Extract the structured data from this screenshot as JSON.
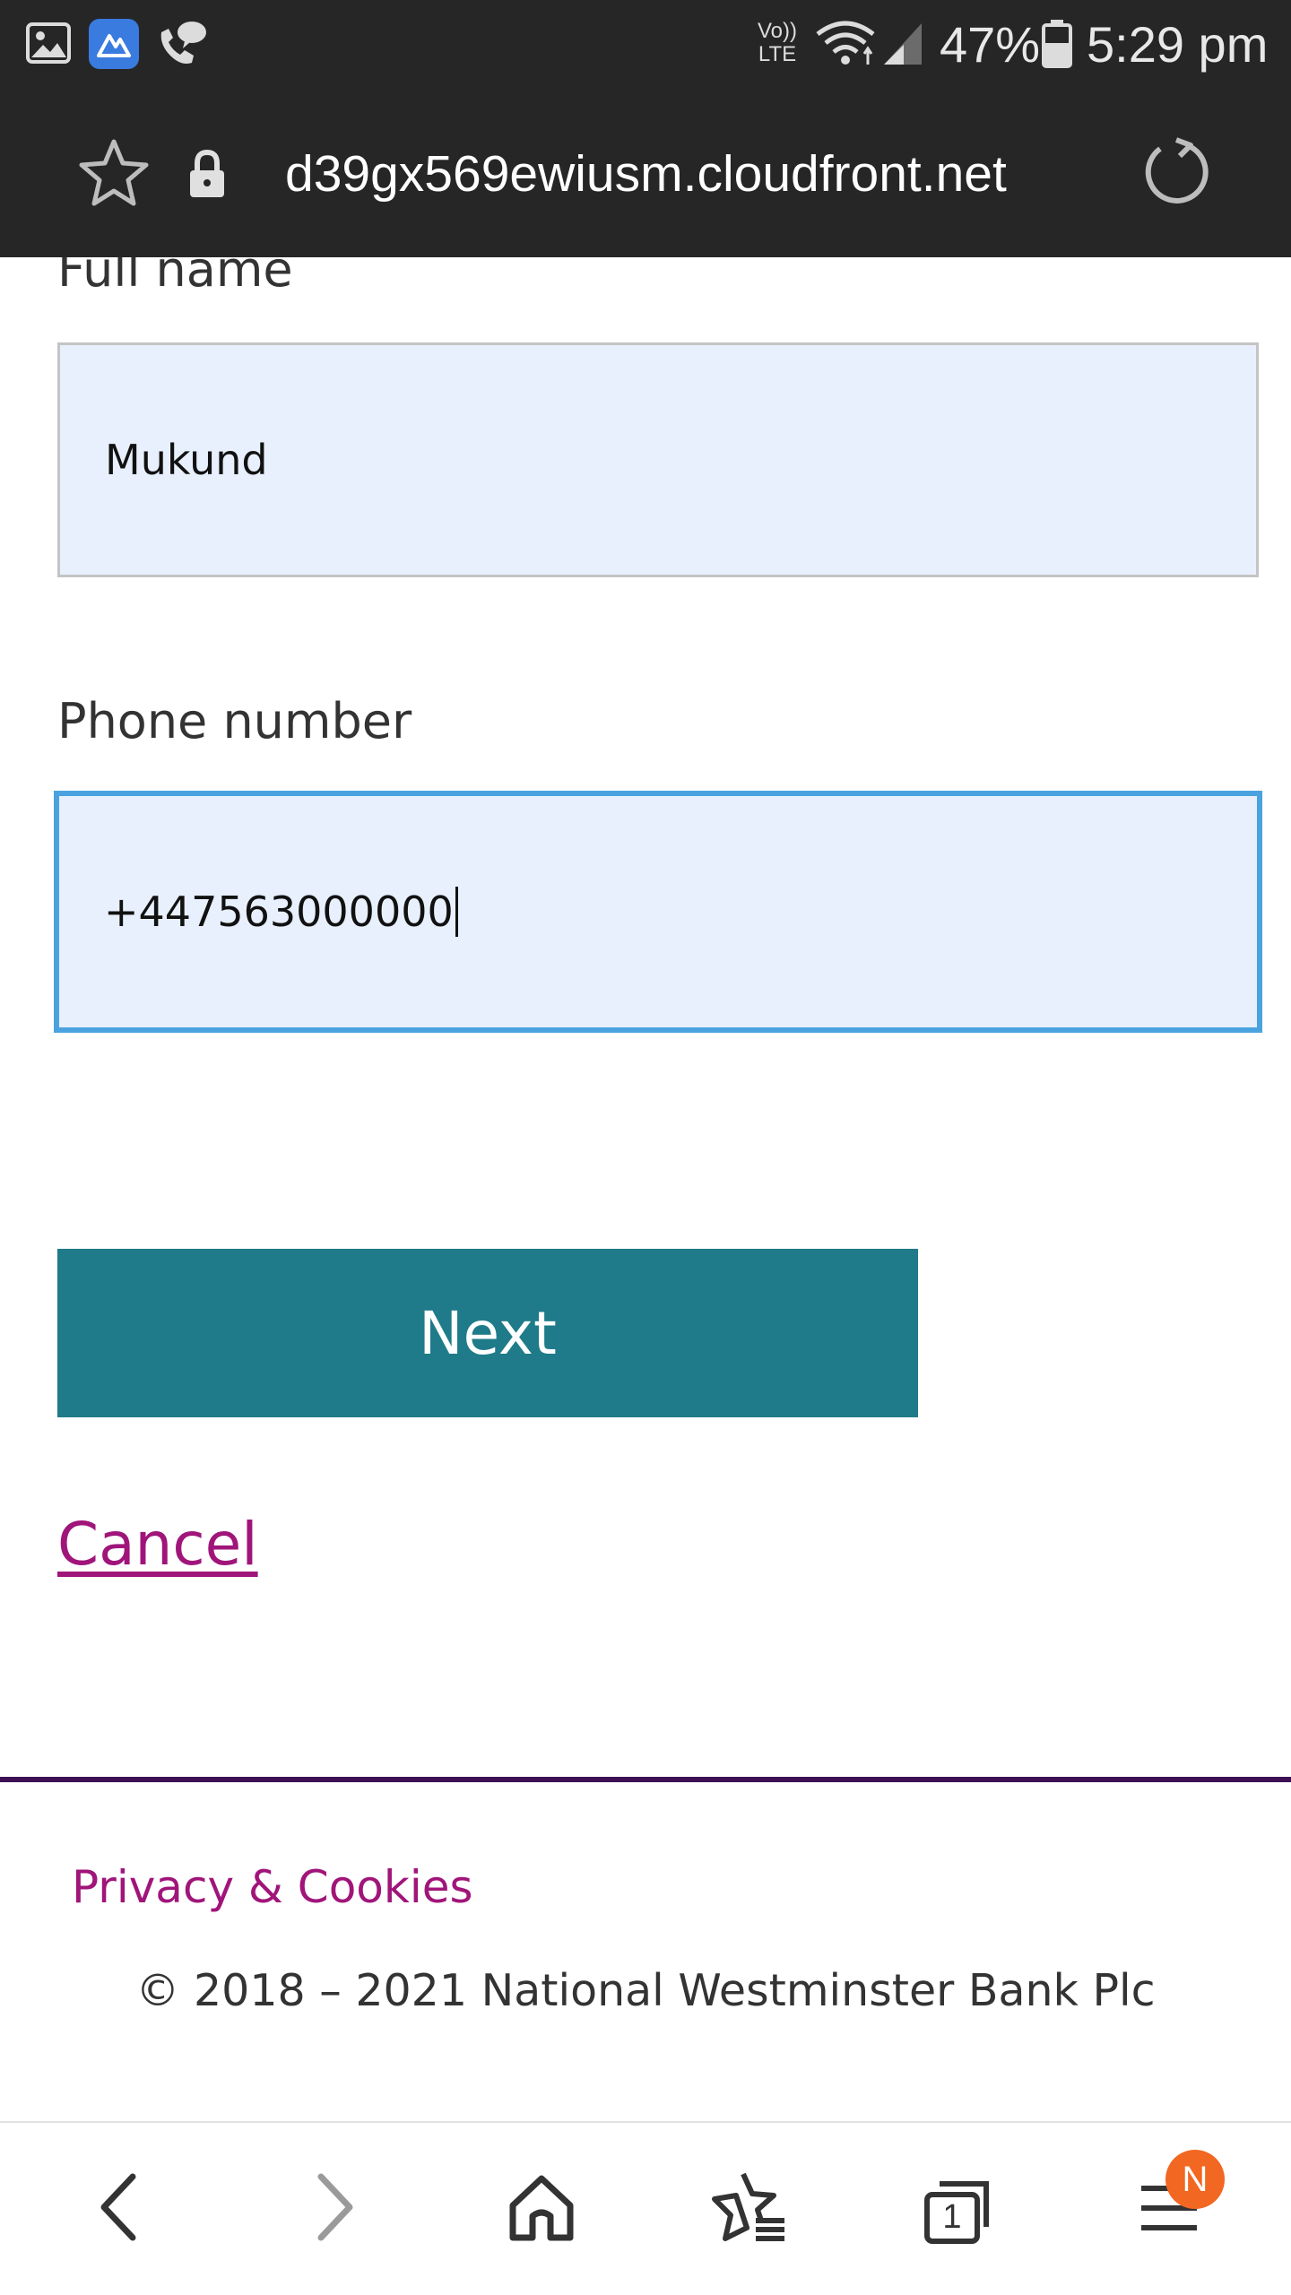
{
  "status_bar": {
    "volte_label_top": "Vo))",
    "volte_label_bottom": "LTE",
    "battery_percent": "47%",
    "time": "5:29 pm"
  },
  "browser": {
    "url": "d39gx569ewiusm.cloudfront.net"
  },
  "form": {
    "full_name_label": "Full name",
    "full_name_value": "Mukund",
    "phone_label": "Phone number",
    "phone_value": "+447563000000",
    "next_label": "Next",
    "cancel_label": "Cancel"
  },
  "footer": {
    "privacy_label": "Privacy & Cookies",
    "copyright": "© 2018 – 2021 National Westminster Bank Plc"
  },
  "bottom_nav": {
    "tabs_count": "1",
    "menu_badge": "N"
  },
  "colors": {
    "accent_button": "#1f7b89",
    "link": "#a0157a",
    "footer_rule": "#3c1053",
    "focus_border": "#4aa3df",
    "badge": "#f26722"
  }
}
